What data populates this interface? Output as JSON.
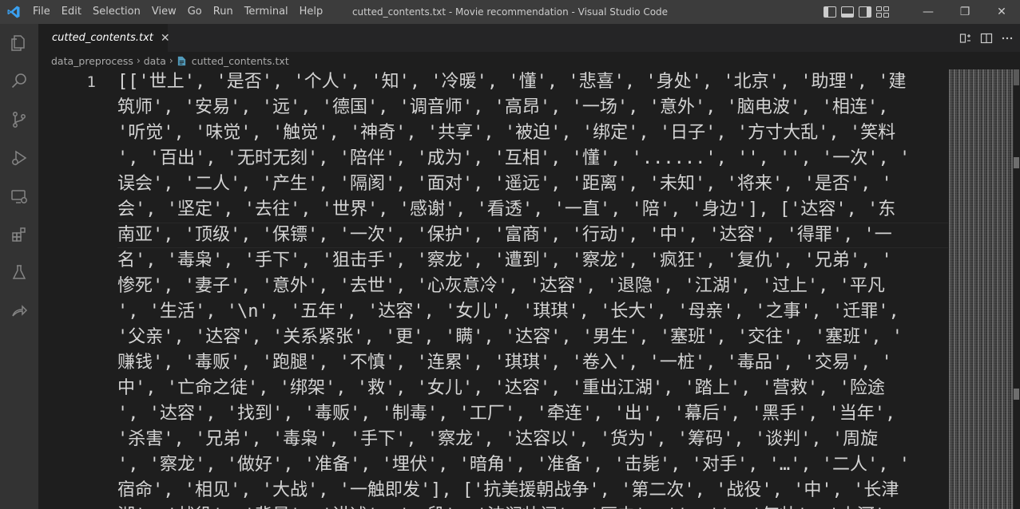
{
  "window": {
    "title": "cutted_contents.txt - Movie recommendation - Visual Studio Code",
    "menu": [
      "File",
      "Edit",
      "Selection",
      "View",
      "Go",
      "Run",
      "Terminal",
      "Help"
    ],
    "controls": {
      "minimize": "—",
      "restore": "❐",
      "close": "✕"
    }
  },
  "activity": [
    "explorer-icon",
    "search-icon",
    "source-control-icon",
    "run-debug-icon",
    "remote-explorer-icon",
    "extensions-icon",
    "testing-icon",
    "live-share-icon"
  ],
  "tab": {
    "label": "cutted_contents.txt",
    "close": "✕"
  },
  "breadcrumb": {
    "parts": [
      "data_preprocess",
      "data"
    ],
    "file": "cutted_contents.txt",
    "sep": "›"
  },
  "editor": {
    "line_number": "1",
    "lines": [
      "[['世上', '是否', '个人', '知', '冷暖', '懂', '悲喜', '身处', '北京', '助理', '建",
      "筑师', '安易', '远', '德国', '调音师', '高昂', '一场', '意外', '脑电波', '相连',",
      "'听觉', '味觉', '触觉', '神奇', '共享', '被迫', '绑定', '日子', '方寸大乱', '笑料",
      "', '百出', '无时无刻', '陪伴', '成为', '互相', '懂', '......', '', '', '一次', '",
      "误会', '二人', '产生', '隔阂', '面对', '遥远', '距离', '未知', '将来', '是否', '",
      "会', '坚定', '去往', '世界', '感谢', '看透', '一直', '陪', '身边'], ['达容', '东",
      "南亚', '顶级', '保镖', '一次', '保护', '富商', '行动', '中', '达容', '得罪', '一",
      "名', '毒枭', '手下', '狙击手', '察龙', '遭到', '察龙', '疯狂', '复仇', '兄弟', '",
      "惨死', '妻子', '意外', '去世', '心灰意冷', '达容', '退隐', '江湖', '过上', '平凡",
      "', '生活', '\\n', '五年', '达容', '女儿', '琪琪', '长大', '母亲', '之事', '迁罪',",
      "'父亲', '达容', '关系紧张', '更', '瞒', '达容', '男生', '塞班', '交往', '塞班', '",
      "赚钱', '毒贩', '跑腿', '不慎', '连累', '琪琪', '卷入', '一桩', '毒品', '交易', '",
      "中', '亡命之徒', '绑架', '救', '女儿', '达容', '重出江湖', '踏上', '营救', '险途",
      "', '达容', '找到', '毒贩', '制毒', '工厂', '牵连', '出', '幕后', '黑手', '当年',",
      "'杀害', '兄弟', '毒枭', '手下', '察龙', '达容以', '货为', '筹码', '谈判', '周旋",
      "', '察龙', '做好', '准备', '埋伏', '暗角', '准备', '击毙', '对手', '…', '二人', '",
      "宿命', '相见', '大战', '一触即发'], ['抗美援朝战争', '第二次', '战役', '中', '长津",
      "湖', '战役', '背景', '讲述', '一段', '波澜壮阔', '历史', '', '', '气壮', '山河'"
    ]
  },
  "colors": {
    "titlebar": "#3c3c3c",
    "activitybar": "#333333",
    "editor_bg": "#1e1e1e",
    "accent": "#007acc",
    "file_icon": "#519aba"
  }
}
